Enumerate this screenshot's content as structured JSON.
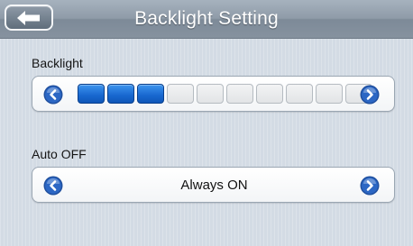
{
  "title_bar": {
    "title": "Backlight Setting"
  },
  "backlight": {
    "label": "Backlight",
    "level": 3,
    "max_level": 10
  },
  "auto_off": {
    "label": "Auto OFF",
    "value": "Always ON"
  },
  "colors": {
    "background": "#d3dbe4",
    "title_bar": "#8f9ba8",
    "segment_on": "#1867cf",
    "segment_off": "#e2e4e6",
    "arrow_button": "#2c67c4"
  },
  "icons": {
    "back": "back-arrow-icon",
    "decrease": "chevron-left-icon",
    "increase": "chevron-right-icon"
  }
}
